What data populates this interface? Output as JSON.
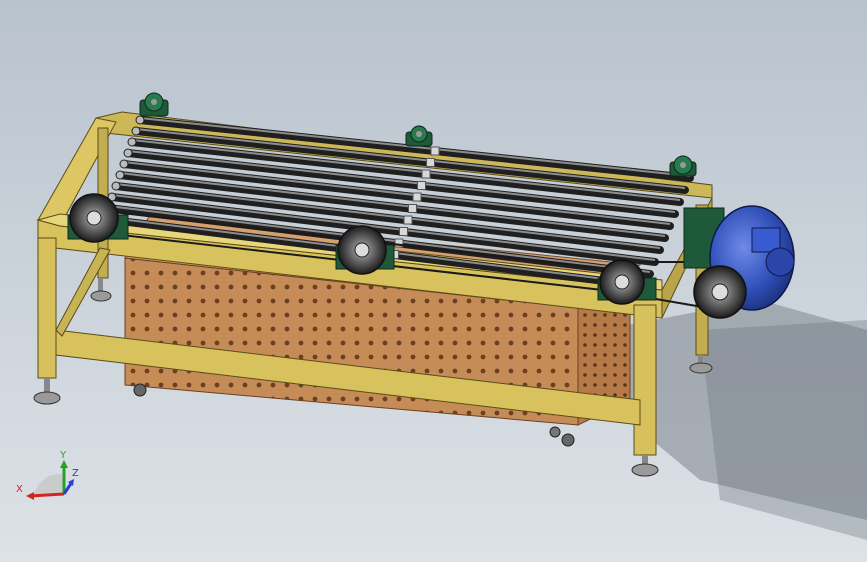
{
  "viewport": {
    "background_top": "#b9c3cd",
    "background_bottom": "#dde2e7"
  },
  "model": {
    "frame_color": "#d4bf5a",
    "bin_color": "#c08a55",
    "roller_color": "#3b3b3b",
    "motor_color": "#2f4fb8",
    "pulley_color": "#4a4a4a",
    "bearing_color": "#1e5a3a"
  },
  "triad": {
    "x_label": "X",
    "y_label": "Y",
    "z_label": "Z",
    "x_color": "#d0261e",
    "y_color": "#27a02a",
    "z_color": "#2a3fd0"
  }
}
